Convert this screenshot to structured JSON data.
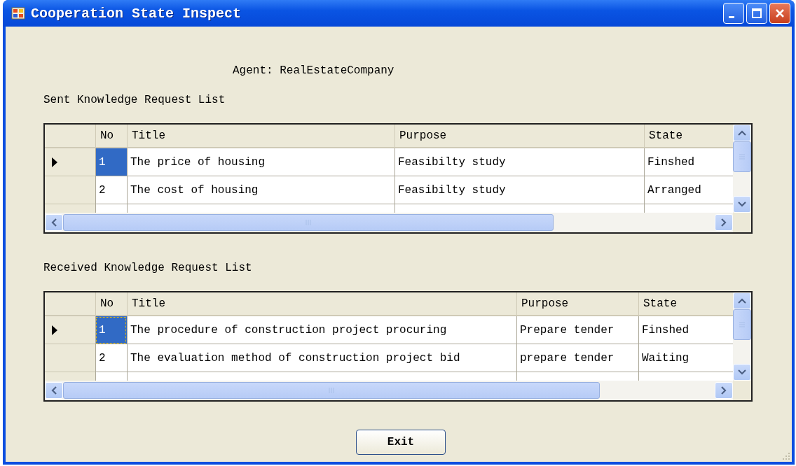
{
  "window": {
    "title": "Cooperation State Inspect"
  },
  "agent_label": "Agent: RealEstateCompany",
  "grids": [
    {
      "label": "Sent Knowledge Request List",
      "columns": [
        "No",
        "Title",
        "Purpose",
        "State"
      ],
      "rows": [
        {
          "current": true,
          "selected": true,
          "cells": [
            "1",
            "The price of housing",
            "Feasibilty study",
            "Finshed"
          ]
        },
        {
          "current": false,
          "selected": false,
          "cells": [
            "2",
            "The cost of housing",
            "Feasibilty study",
            "Arranged"
          ]
        }
      ]
    },
    {
      "label": "Received Knowledge Request List",
      "columns": [
        "No",
        "Title",
        "Purpose",
        "State"
      ],
      "rows": [
        {
          "current": true,
          "selected": true,
          "cells": [
            "1",
            "The procedure of construction project procuring",
            "Prepare tender",
            "Finshed"
          ]
        },
        {
          "current": false,
          "selected": false,
          "cells": [
            "2",
            "The evaluation method of construction project bid",
            "prepare tender",
            "Waiting"
          ]
        }
      ]
    }
  ],
  "buttons": [
    "Exit"
  ]
}
